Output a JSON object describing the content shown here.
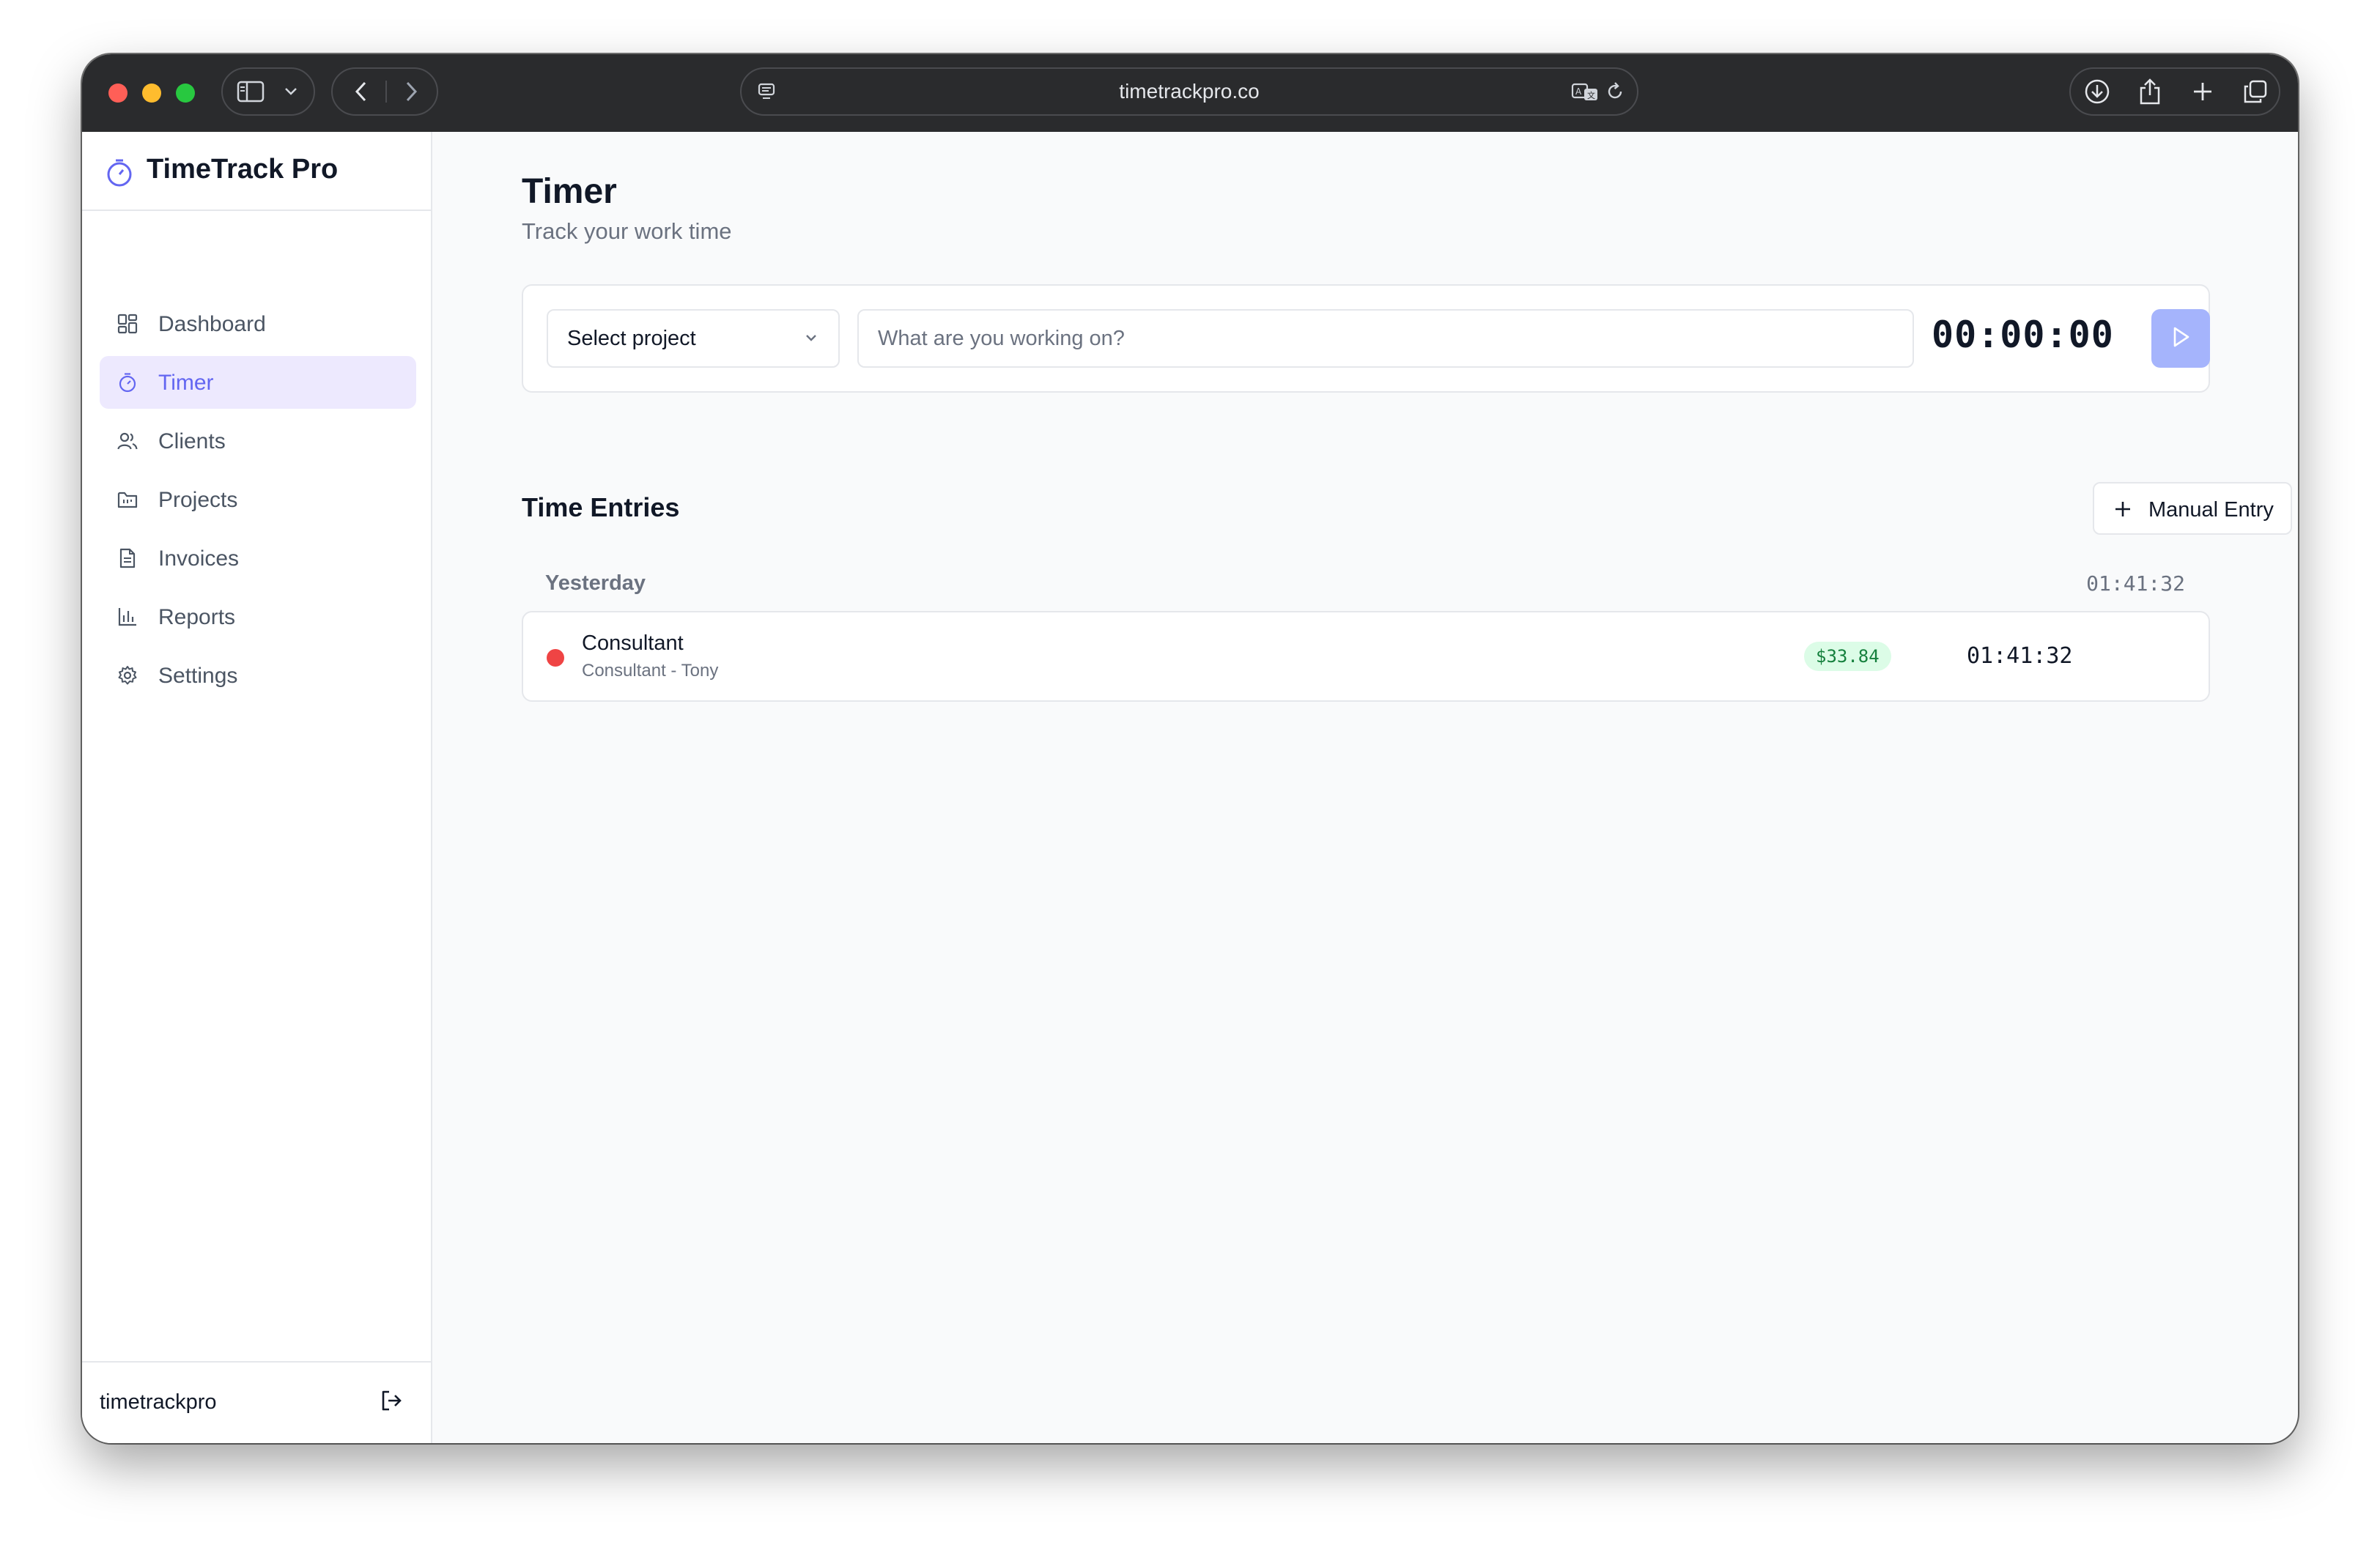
{
  "browser": {
    "url": "timetrackpro.co"
  },
  "sidebar": {
    "brand": "TimeTrack Pro",
    "items": [
      {
        "label": "Dashboard",
        "icon": "dashboard-icon",
        "active": false
      },
      {
        "label": "Timer",
        "icon": "timer-icon",
        "active": true
      },
      {
        "label": "Clients",
        "icon": "users-icon",
        "active": false
      },
      {
        "label": "Projects",
        "icon": "folder-icon",
        "active": false
      },
      {
        "label": "Invoices",
        "icon": "document-icon",
        "active": false
      },
      {
        "label": "Reports",
        "icon": "bar-chart-icon",
        "active": false
      },
      {
        "label": "Settings",
        "icon": "gear-icon",
        "active": false
      }
    ],
    "footer_user": "timetrackpro"
  },
  "main": {
    "title": "Timer",
    "subtitle": "Track your work time",
    "timer": {
      "project_select_label": "Select project",
      "task_placeholder": "What are you working on?",
      "elapsed": "00:00:00"
    },
    "entries_section": {
      "title": "Time Entries",
      "manual_entry_label": "Manual Entry",
      "groups": [
        {
          "label": "Yesterday",
          "total": "01:41:32",
          "entries": [
            {
              "title": "Consultant",
              "subtitle": "Consultant - Tony",
              "amount": "$33.84",
              "duration": "01:41:32",
              "color": "#ef4444"
            }
          ]
        }
      ]
    }
  },
  "colors": {
    "accent": "#6366f1",
    "accent_light": "#ede9fe",
    "play_button": "#a5b4fc",
    "amount_bg": "#dcfce7",
    "amount_text": "#15803d"
  }
}
